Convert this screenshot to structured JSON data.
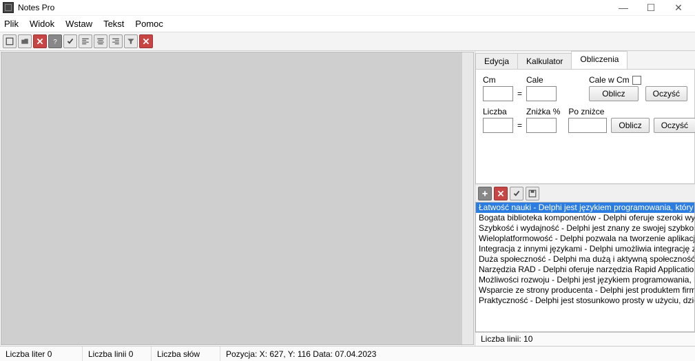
{
  "app": {
    "title": "Notes Pro"
  },
  "menu": {
    "file": "Plik",
    "view": "Widok",
    "insert": "Wstaw",
    "text": "Tekst",
    "help": "Pomoc"
  },
  "tabs": {
    "edit": "Edycja",
    "calculator": "Kalkulator",
    "calculations": "Obliczenia"
  },
  "calc": {
    "cm": "Cm",
    "inch": "Cale",
    "inch_in_cm": "Cale w  Cm",
    "number": "Liczba",
    "discount_pct": "Zniżka %",
    "after_discount": "Po zniżce",
    "compute": "Oblicz",
    "clear": "Oczyść"
  },
  "list": {
    "items": [
      "Łatwość nauki - Delphi jest językiem programowania, który j",
      "Bogata biblioteka komponentów - Delphi oferuje szeroki wy",
      "Szybkość i wydajność - Delphi jest znany ze swojej szybkości",
      "Wieloplatformowość - Delphi pozwala na tworzenie aplikacji",
      "Integracja z innymi językami - Delphi umożliwia integrację z",
      "Duża społeczność - Delphi ma dużą i aktywną społeczność p",
      "Narzędzia RAD - Delphi oferuje narzędzia Rapid Application I",
      "Możliwości rozwoju - Delphi jest językiem programowania, k",
      "Wsparcie ze strony producenta - Delphi jest produktem firmy",
      "Praktyczność - Delphi jest stosunkowo prosty w użyciu, dzięk"
    ],
    "line_count": "Liczba linii: 10"
  },
  "status": {
    "letters": "Liczba liter 0",
    "lines": "Liczba linii 0",
    "words": "Liczba słów",
    "pos_date": "Pozycja: X: 627, Y: 116  Data: 07.04.2023"
  }
}
